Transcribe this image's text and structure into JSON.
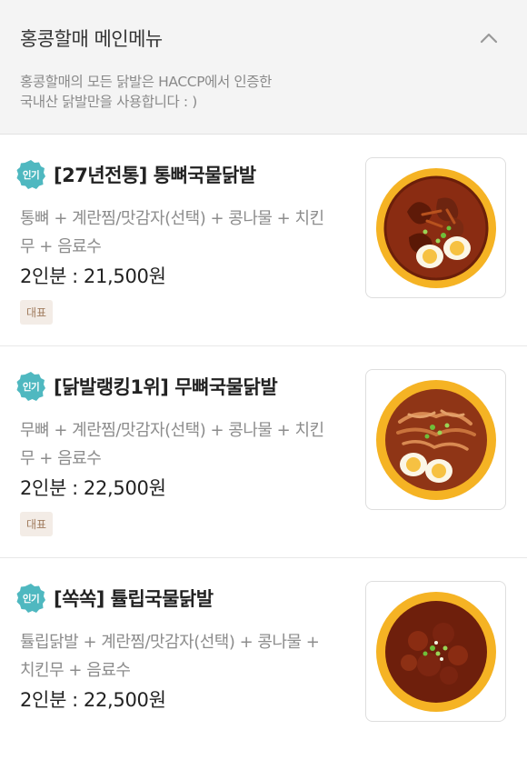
{
  "header": {
    "title": "홍콩할매 메인메뉴",
    "description_line1": "홍콩할매의 모든 닭발은 HACCP에서 인증한",
    "description_line2": "국내산 닭발만을 사용합니다 : )",
    "collapse_icon": "chevron-up-icon"
  },
  "menu": {
    "popular_badge": "인기",
    "rep_tag": "대표",
    "price_separator": ":",
    "items": [
      {
        "name": "[27년전통] 통뼈국물닭발",
        "desc_line1": "통뼈 + 계란찜/맛감자(선택) + 콩나물 + 치킨",
        "desc_line2": "무 + 음료수",
        "serving": "2인분",
        "price": "21,500원",
        "tag": "대표",
        "image": "bone-in-chicken-feet-soup-photo"
      },
      {
        "name": "[닭발랭킹1위] 무뼈국물닭발",
        "desc_line1": "무뼈 + 계란찜/맛감자(선택) + 콩나물 + 치킨",
        "desc_line2": "무 + 음료수",
        "serving": "2인분",
        "price": "22,500원",
        "tag": "대표",
        "image": "boneless-chicken-feet-soup-photo"
      },
      {
        "name": "[쏙쏙] 튤립국물닭발",
        "desc_line1": "튤립닭발 + 계란찜/맛감자(선택) + 콩나물 +",
        "desc_line2": "치킨무 + 음료수",
        "serving": "2인분",
        "price": "22,500원",
        "image": "tulip-chicken-feet-soup-photo"
      }
    ]
  },
  "colors": {
    "badge": "#4fb8c0",
    "bowl_rim": "#f5b324",
    "broth": "#8a2c12",
    "egg_yolk": "#f6c142"
  }
}
